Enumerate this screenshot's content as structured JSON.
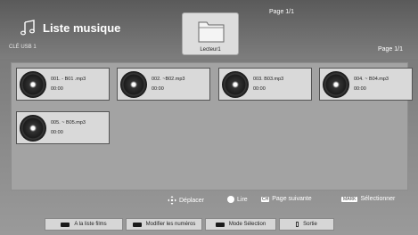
{
  "header": {
    "title": "Liste musique",
    "device": "CLÉ USB 1",
    "page_top": "Page 1/1",
    "page_right": "Page 1/1",
    "folder_label": "Lecteur1"
  },
  "tracks": [
    {
      "name": "001. - B01 .mp3",
      "duration": "00:00"
    },
    {
      "name": "002. ~B02.mp3",
      "duration": "00:00"
    },
    {
      "name": "003. B03.mp3",
      "duration": "00:00"
    },
    {
      "name": "004. ~ B04.mp3",
      "duration": "00:00"
    },
    {
      "name": "005. ~ B05.mp3",
      "duration": "00:00"
    }
  ],
  "hints": {
    "move": "Déplacer",
    "play": "Lire",
    "next_page_key": "CH",
    "next_page": "Page suivante",
    "mark_key": "MARK",
    "select": "Sélectionner"
  },
  "buttons": {
    "films": "A la liste films",
    "numbers": "Modifier les numéros",
    "selection": "Mode Sélection",
    "exit": "Sortie"
  }
}
